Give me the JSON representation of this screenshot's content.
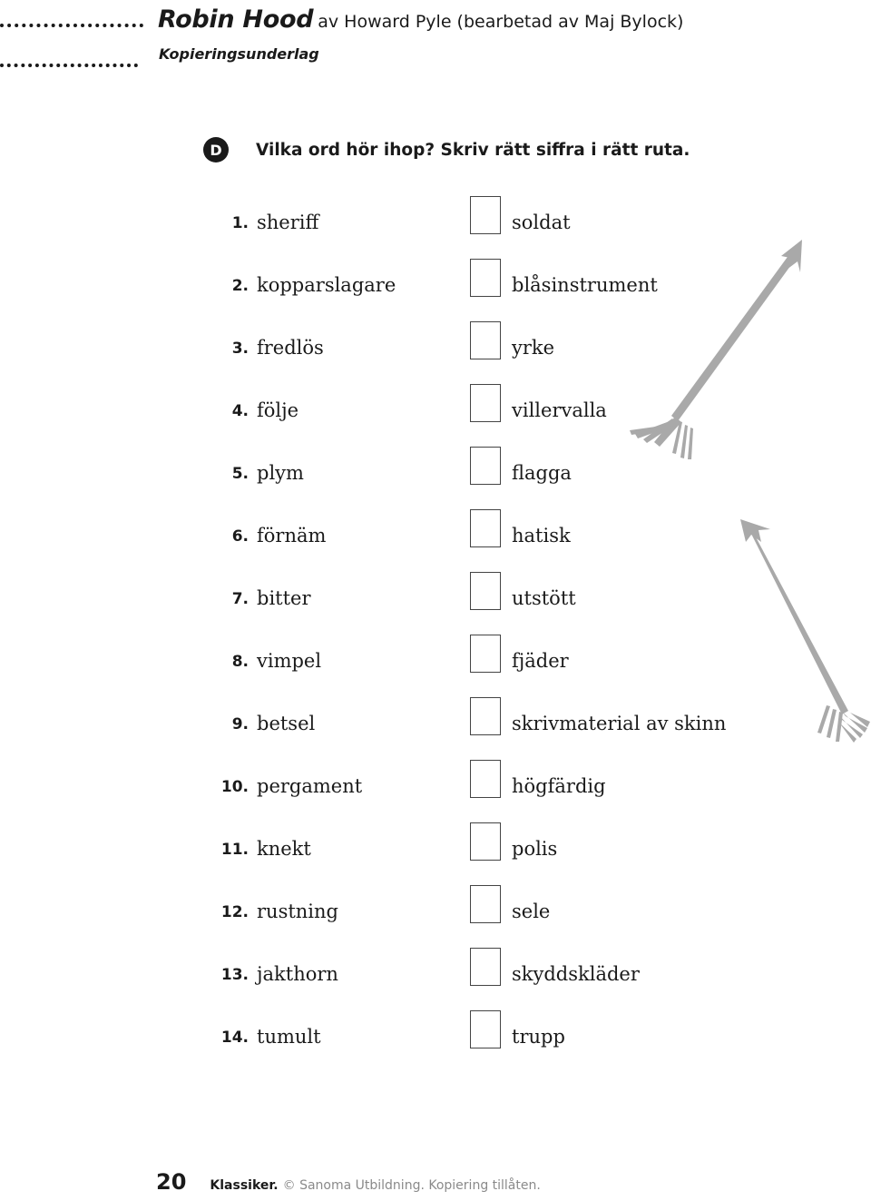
{
  "header": {
    "title_main": "Robin Hood",
    "title_sub": "av Howard Pyle (bearbetad av Maj Bylock)",
    "subtitle": "Kopieringsunderlag"
  },
  "task": {
    "badge_letter": "D",
    "instruction": "Vilka ord hör ihop? Skriv rätt siffra i rätt ruta."
  },
  "exercise": {
    "box_value": "",
    "rows": [
      {
        "num": "1.",
        "word": "sheriff",
        "match": "soldat"
      },
      {
        "num": "2.",
        "word": "kopparslagare",
        "match": "blåsinstrument"
      },
      {
        "num": "3.",
        "word": "fredlös",
        "match": "yrke"
      },
      {
        "num": "4.",
        "word": "följe",
        "match": "villervalla"
      },
      {
        "num": "5.",
        "word": "plym",
        "match": "flagga"
      },
      {
        "num": "6.",
        "word": "förnäm",
        "match": "hatisk"
      },
      {
        "num": "7.",
        "word": "bitter",
        "match": "utstött"
      },
      {
        "num": "8.",
        "word": "vimpel",
        "match": "fjäder"
      },
      {
        "num": "9.",
        "word": "betsel",
        "match": "skrivmaterial av skinn"
      },
      {
        "num": "10.",
        "word": "pergament",
        "match": "högfärdig"
      },
      {
        "num": "11.",
        "word": "knekt",
        "match": "polis"
      },
      {
        "num": "12.",
        "word": "rustning",
        "match": "sele"
      },
      {
        "num": "13.",
        "word": "jakthorn",
        "match": "skyddskläder"
      },
      {
        "num": "14.",
        "word": "tumult",
        "match": "trupp"
      }
    ]
  },
  "decoration": {
    "arrow_color": "#a9a9a9",
    "arrows": [
      {
        "name": "arrow-up-right",
        "direction": "up-right"
      },
      {
        "name": "arrow-up-left",
        "direction": "up-left"
      }
    ]
  },
  "footer": {
    "page_number": "20",
    "series": "Klassiker.",
    "copyright": "© Sanoma Utbildning. Kopiering tillåten."
  },
  "colors": {
    "text": "#1a1a1a",
    "box_border": "#444444",
    "footer_gray": "#8a8a8a",
    "page_bg": "#ffffff"
  }
}
